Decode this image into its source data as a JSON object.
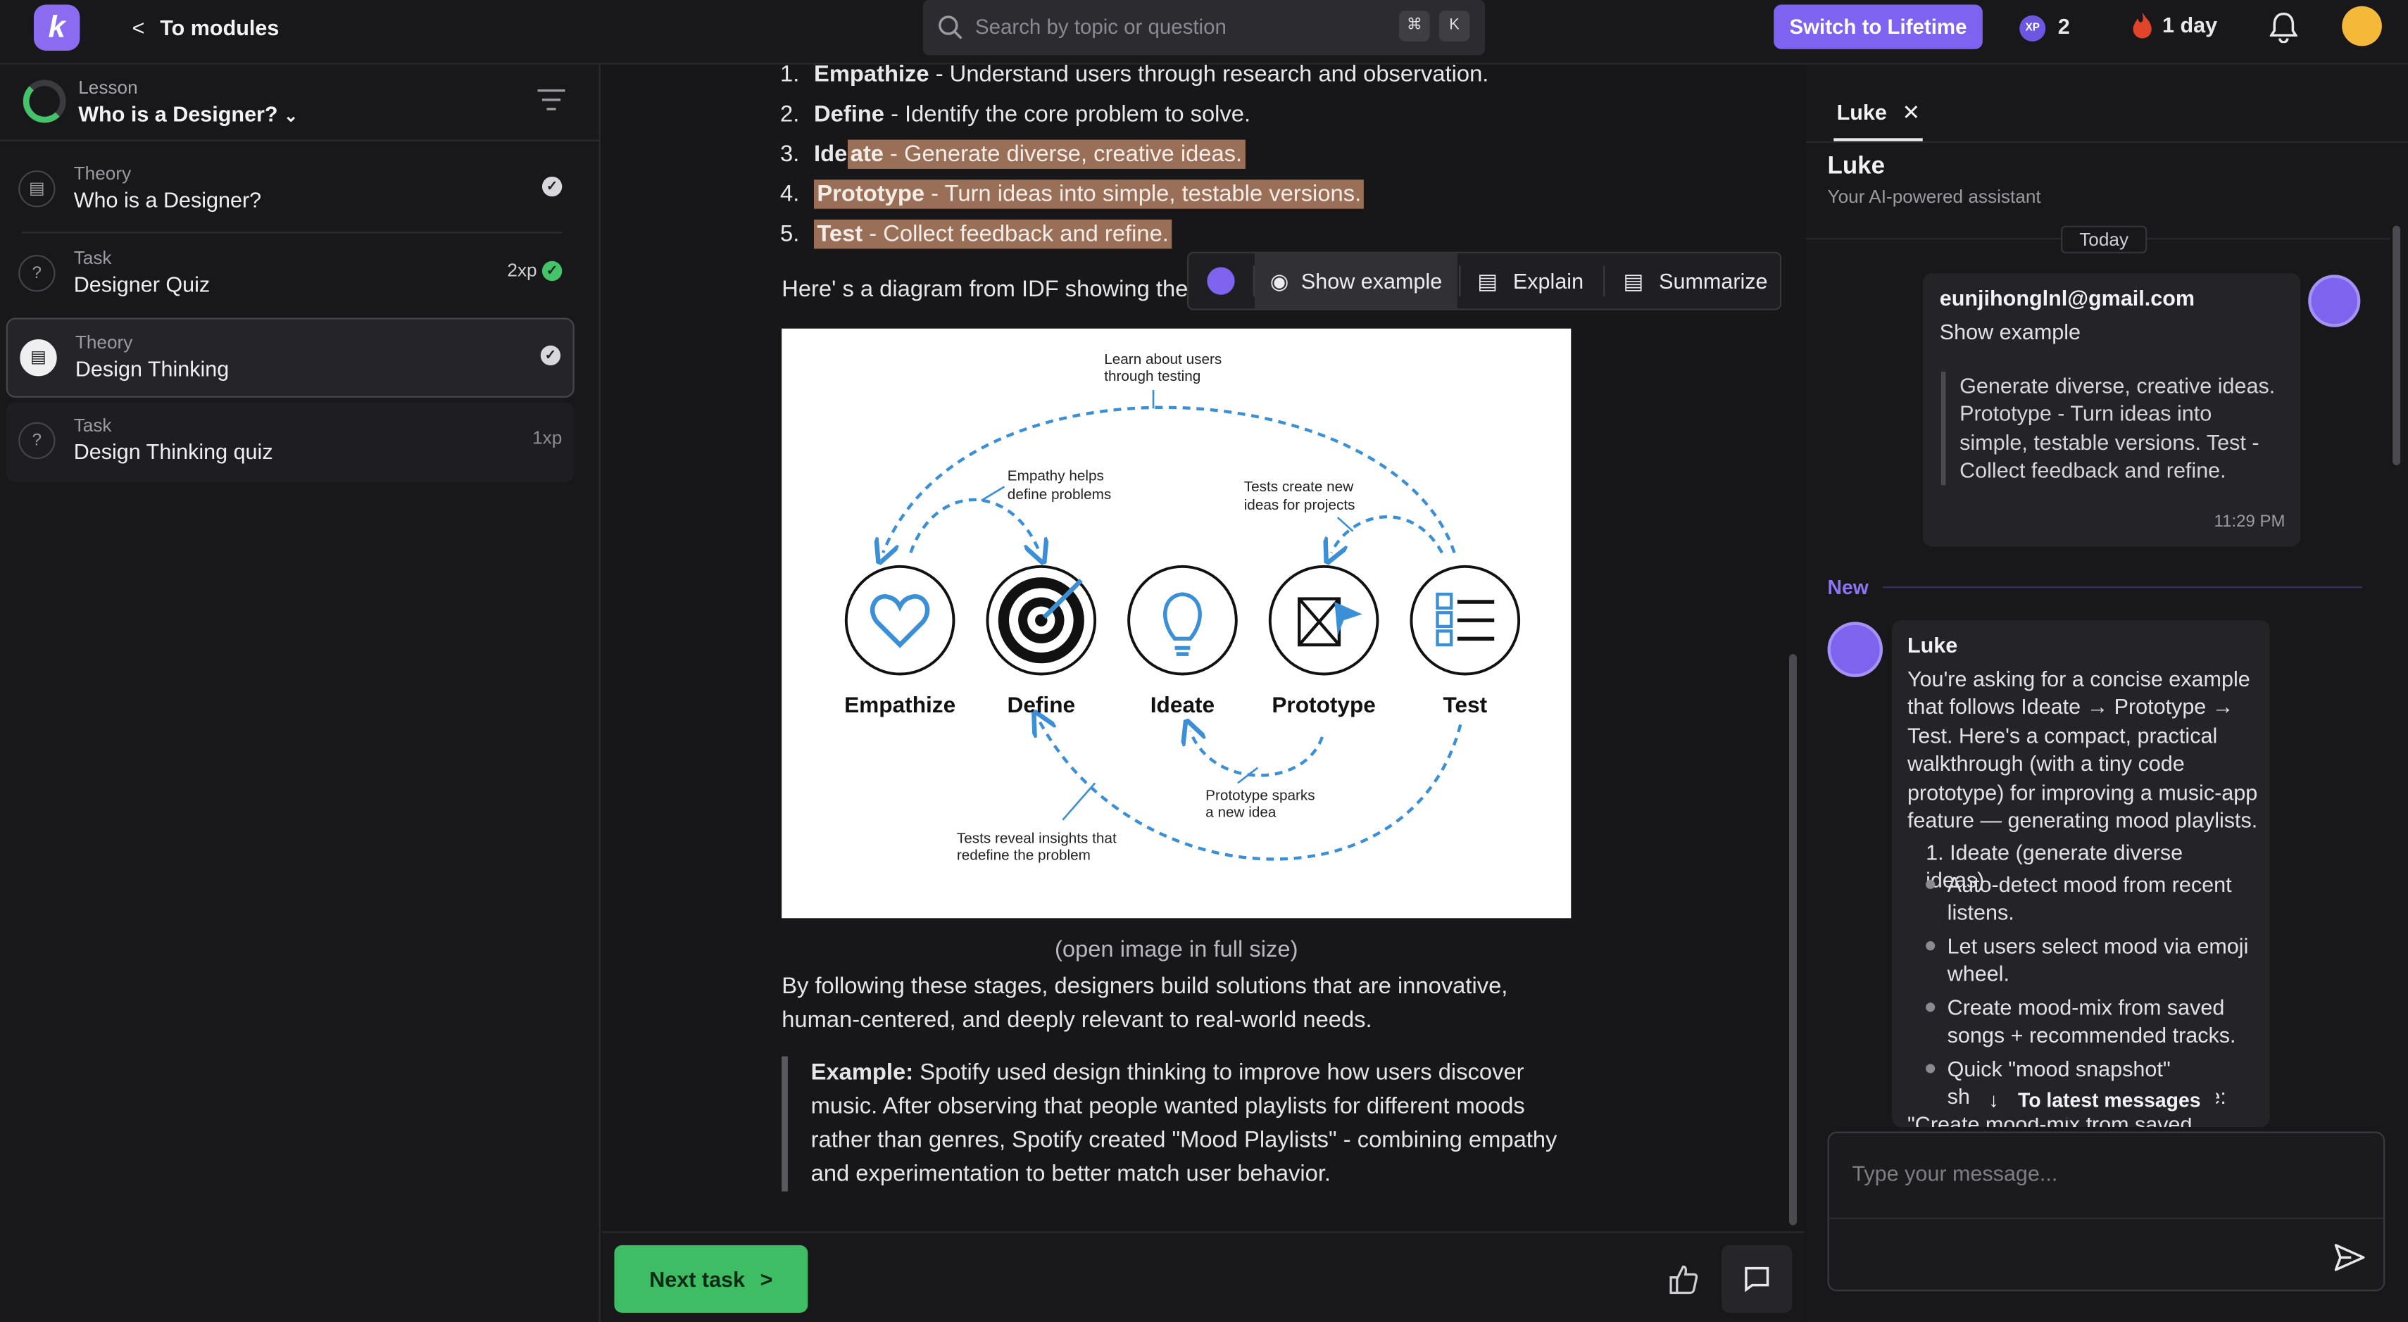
{
  "topbar": {
    "logo": "k",
    "back_label": "To modules",
    "search_placeholder": "Search by topic or question",
    "kbd_cmd": "⌘",
    "kbd_k": "K",
    "lifetime_button": "Switch to Lifetime",
    "xp_badge": "XP",
    "xp_value": "2",
    "streak": "1 day"
  },
  "sidebar": {
    "lesson_label": "Lesson",
    "lesson_title": "Who is a Designer?",
    "items": [
      {
        "type": "Theory",
        "name": "Who is a Designer?",
        "xp": "",
        "status": "done"
      },
      {
        "type": "Task",
        "name": "Designer Quiz",
        "xp": "2xp",
        "status": "done-green"
      },
      {
        "type": "Theory",
        "name": "Design Thinking",
        "xp": "",
        "status": "done"
      },
      {
        "type": "Task",
        "name": "Design Thinking quiz",
        "xp": "1xp",
        "status": ""
      }
    ]
  },
  "content": {
    "steps": [
      {
        "num": "1.",
        "term": "Empathize",
        "desc": " - Understand users through research and observation."
      },
      {
        "num": "2.",
        "term": "Define",
        "desc": " - Identify the core problem to solve."
      },
      {
        "num": "3.",
        "term_a": "Ide",
        "term_b": "ate",
        "desc": " - Generate diverse, creative ideas."
      },
      {
        "num": "4.",
        "term": "Prototype",
        "desc": " - Turn ideas into simple, testable versions."
      },
      {
        "num": "5.",
        "term": "Test",
        "desc": " - Collect feedback and refine."
      }
    ],
    "intro_line": "Here' s a diagram from IDF showing the f",
    "toolbar": {
      "show_example": "Show example",
      "explain": "Explain",
      "summarize": "Summarize"
    },
    "diagram": {
      "stages": [
        "Empathize",
        "Define",
        "Ideate",
        "Prototype",
        "Test"
      ],
      "notes": {
        "learn": [
          "Learn about users",
          "through testing"
        ],
        "empathy": [
          "Empathy helps",
          "define problems"
        ],
        "tests_create": [
          "Tests create new",
          "ideas for projects"
        ],
        "proto_sparks": [
          "Prototype sparks",
          "a new idea"
        ],
        "tests_reveal": [
          "Tests reveal insights that",
          "redefine the problem"
        ]
      }
    },
    "caption": "(open image in full size)",
    "para": "By following these stages, designers build solutions that are innovative, human-centered, and deeply relevant to real-world needs.",
    "example_label": "Example:",
    "example_text": " Spotify used design thinking to improve how users discover music. After observing that people wanted playlists for different moods rather than genres, Spotify created \"Mood Playlists\" - combining empathy and experimentation to better match user behavior."
  },
  "bottom": {
    "next_task": "Next task"
  },
  "chat": {
    "tab": "Luke",
    "name": "Luke",
    "subtitle": "Your AI-powered assistant",
    "today": "Today",
    "user_message": {
      "email": "eunjihonglnl@gmail.com",
      "text": "Show example",
      "quote": "Generate diverse, creative ideas. Prototype - Turn ideas into simple, testable versions. Test - Collect feedback and refine.",
      "time": "11:29 PM"
    },
    "new_label": "New",
    "assistant_message": {
      "name": "Luke",
      "intro": "You're asking for a concise example that follows Ideate → Prototype → Test. Here's a compact, practical walkthrough (with a tiny code prototype) for improving a music-app feature — generating mood playlists.",
      "step1": "1. Ideate (generate diverse ideas)",
      "bullets": [
        "Auto-detect mood from recent listens.",
        "Let users select mood via emoji wheel.",
        "Create mood-mix from saved songs + recommended tracks.",
        "Quick \"mood snapshot\""
      ],
      "tail_left": "sh",
      "tail_right": "e:",
      "tail_line": "\"Create mood-mix from saved"
    },
    "latest_button": "To latest messages",
    "input_placeholder": "Type your message..."
  }
}
